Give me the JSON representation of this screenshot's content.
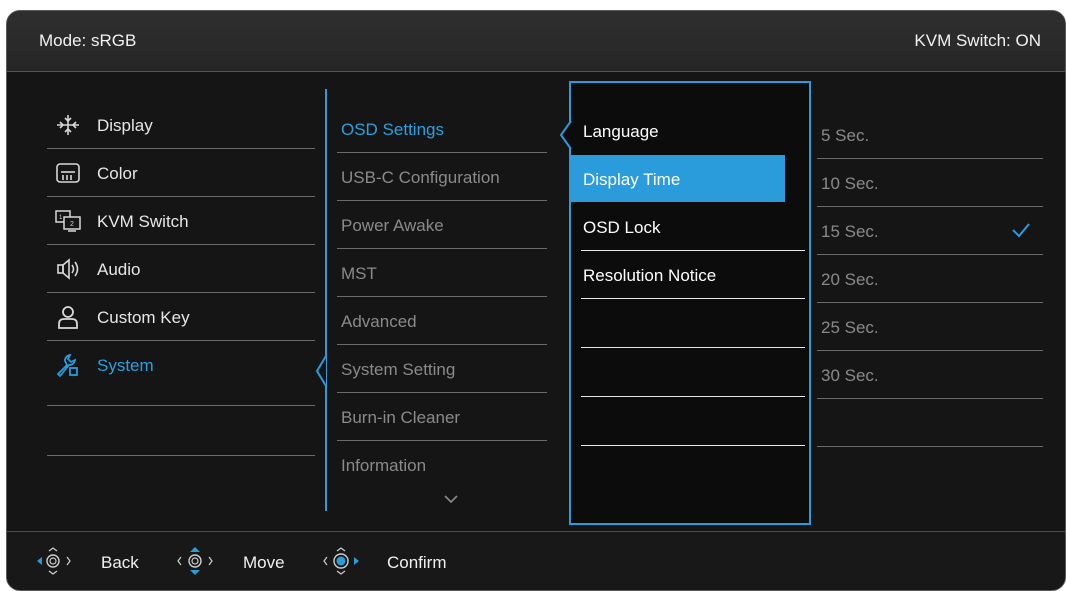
{
  "header": {
    "mode": "Mode: sRGB",
    "kvm": "KVM Switch: ON"
  },
  "main_menu": [
    {
      "label": "Display",
      "icon": "display-icon"
    },
    {
      "label": "Color",
      "icon": "color-icon"
    },
    {
      "label": "KVM Switch",
      "icon": "kvm-switch-icon"
    },
    {
      "label": "Audio",
      "icon": "audio-icon"
    },
    {
      "label": "Custom Key",
      "icon": "custom-key-icon"
    },
    {
      "label": "System",
      "icon": "system-icon"
    }
  ],
  "sub_menu": [
    {
      "label": "OSD Settings"
    },
    {
      "label": "USB-C Configuration"
    },
    {
      "label": "Power Awake"
    },
    {
      "label": "MST"
    },
    {
      "label": "Advanced"
    },
    {
      "label": "System Setting"
    },
    {
      "label": "Burn-in Cleaner"
    },
    {
      "label": "Information"
    }
  ],
  "options": [
    {
      "label": "Language"
    },
    {
      "label": "Display Time"
    },
    {
      "label": "OSD Lock"
    },
    {
      "label": "Resolution Notice"
    }
  ],
  "values": [
    {
      "label": "5 Sec."
    },
    {
      "label": "10 Sec."
    },
    {
      "label": "15 Sec."
    },
    {
      "label": "20 Sec."
    },
    {
      "label": "25 Sec."
    },
    {
      "label": "30 Sec."
    }
  ],
  "footer": {
    "back": "Back",
    "move": "Move",
    "confirm": "Confirm"
  },
  "colors": {
    "accent": "#2a9bdb",
    "background": "#151515"
  }
}
